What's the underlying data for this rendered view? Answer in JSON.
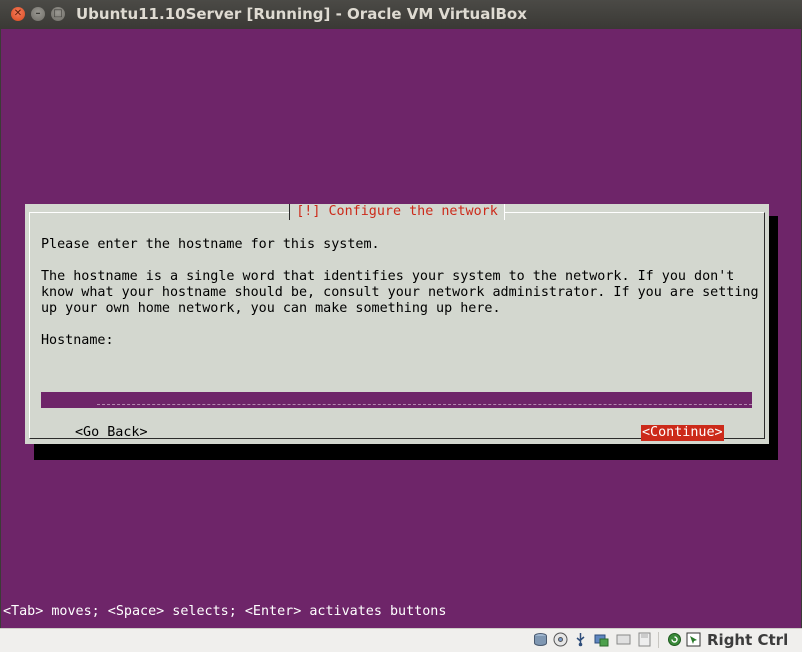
{
  "window": {
    "title": "Ubuntu11.10Server [Running] - Oracle VM VirtualBox"
  },
  "dialog": {
    "title": "[!] Configure the network",
    "prompt": "Please enter the hostname for this system.",
    "description_lines": [
      "The hostname is a single word that identifies your system to the network. If you don't",
      "know what your hostname should be, consult your network administrator. If you are setting",
      "up your own home network, you can make something up here."
    ],
    "hostname_label": "Hostname:",
    "hostname_value": "ubuntu",
    "go_back_label": "<Go Back>",
    "continue_label": "<Continue>"
  },
  "help_line": "<Tab> moves; <Space> selects; <Enter> activates buttons",
  "statusbar": {
    "icons": [
      "hard-disk-icon",
      "optical-drive-icon",
      "usb-icon",
      "shared-folders-icon",
      "network-icon",
      "floppy-icon",
      "display-icon",
      "mouse-integration-icon",
      "host-key-icon"
    ],
    "host_key": "Right Ctrl"
  },
  "colors": {
    "vm_background": "#6e2569",
    "dialog_background": "#d3d7cf",
    "accent_red": "#cc2a1a"
  }
}
